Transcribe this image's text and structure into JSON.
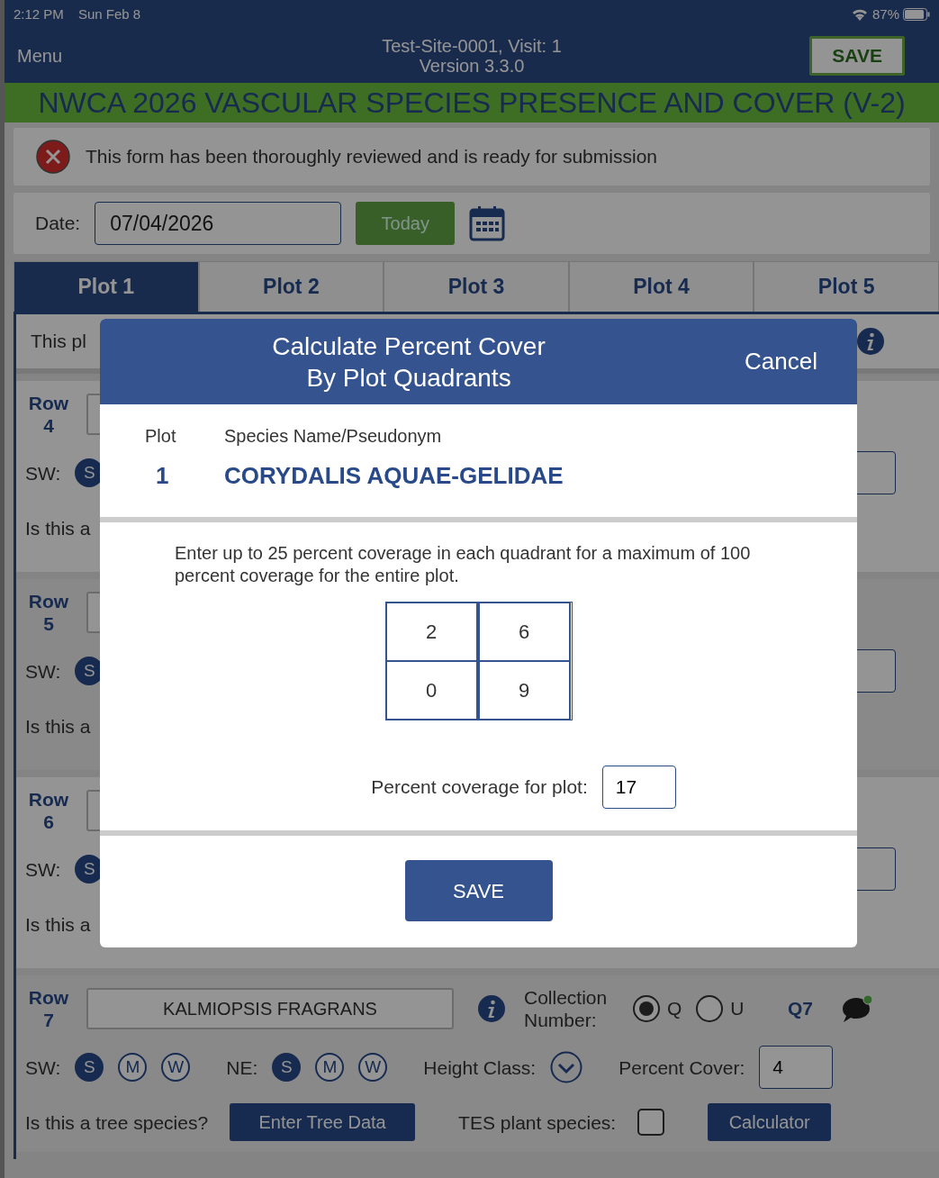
{
  "status_bar": {
    "time": "2:12 PM",
    "date": "Sun Feb 8",
    "battery": "87%"
  },
  "header": {
    "menu": "Menu",
    "title": "Test-Site-0001, Visit: 1",
    "subtitle": "Version 3.3.0",
    "save": "SAVE"
  },
  "form_title": "NWCA 2026 VASCULAR SPECIES PRESENCE AND COVER (V-2)",
  "review": {
    "checked": false,
    "text": "This form has been thoroughly reviewed and is ready for submission"
  },
  "date": {
    "label": "Date:",
    "value": "07/04/2026",
    "today": "Today"
  },
  "tabs": [
    {
      "label": "Plot 1",
      "selected": true
    },
    {
      "label": "Plot 2",
      "selected": false
    },
    {
      "label": "Plot 3",
      "selected": false
    },
    {
      "label": "Plot 4",
      "selected": false
    },
    {
      "label": "Plot 5",
      "selected": false
    }
  ],
  "plot_note": "This pl",
  "rows": [
    {
      "kind": "partial",
      "label": "Row",
      "number": "4",
      "sw_label": "SW:",
      "sw": [
        {
          "letter": "S",
          "selected": true
        }
      ],
      "question": "Is this a"
    },
    {
      "kind": "partial",
      "label": "Row",
      "number": "5",
      "sw_label": "SW:",
      "sw": [
        {
          "letter": "S",
          "selected": true
        }
      ],
      "question": "Is this a"
    },
    {
      "kind": "partial",
      "label": "Row",
      "number": "6",
      "sw_label": "SW:",
      "sw": [
        {
          "letter": "S",
          "selected": true
        }
      ],
      "question": "Is this a"
    },
    {
      "kind": "full",
      "label": "Row",
      "number": "7",
      "species": "KALMIOPSIS FRAGRANS",
      "collection_label": "Collection Number:",
      "radios": [
        {
          "label": "Q",
          "selected": true
        },
        {
          "label": "U",
          "selected": false
        }
      ],
      "code": "Q7",
      "sw_label": "SW:",
      "sw": [
        {
          "letter": "S",
          "selected": true
        },
        {
          "letter": "M",
          "selected": false
        },
        {
          "letter": "W",
          "selected": false
        }
      ],
      "ne_label": "NE:",
      "ne": [
        {
          "letter": "S",
          "selected": true
        },
        {
          "letter": "M",
          "selected": false
        },
        {
          "letter": "W",
          "selected": false
        }
      ],
      "height_label": "Height Class:",
      "percent_label": "Percent Cover:",
      "percent": "4",
      "question": "Is this a tree species?",
      "tree_button": "Enter Tree Data",
      "tes_label": "TES plant species:",
      "tes_checked": false,
      "calculator": "Calculator"
    }
  ],
  "modal": {
    "title": "Calculate Percent Cover",
    "title_line2": "By Plot Quadrants",
    "cancel": "Cancel",
    "plot_header": "Plot",
    "species_header": "Species Name/Pseudonym",
    "plot": "1",
    "species": "CORYDALIS AQUAE-GELIDAE",
    "instructions": "Enter up to 25 percent coverage in each quadrant for a maximum of 100 percent coverage for the entire plot.",
    "quadrants": [
      "2",
      "6",
      "0",
      "9"
    ],
    "total_label": "Percent coverage for plot:",
    "total": "17",
    "save": "SAVE"
  }
}
